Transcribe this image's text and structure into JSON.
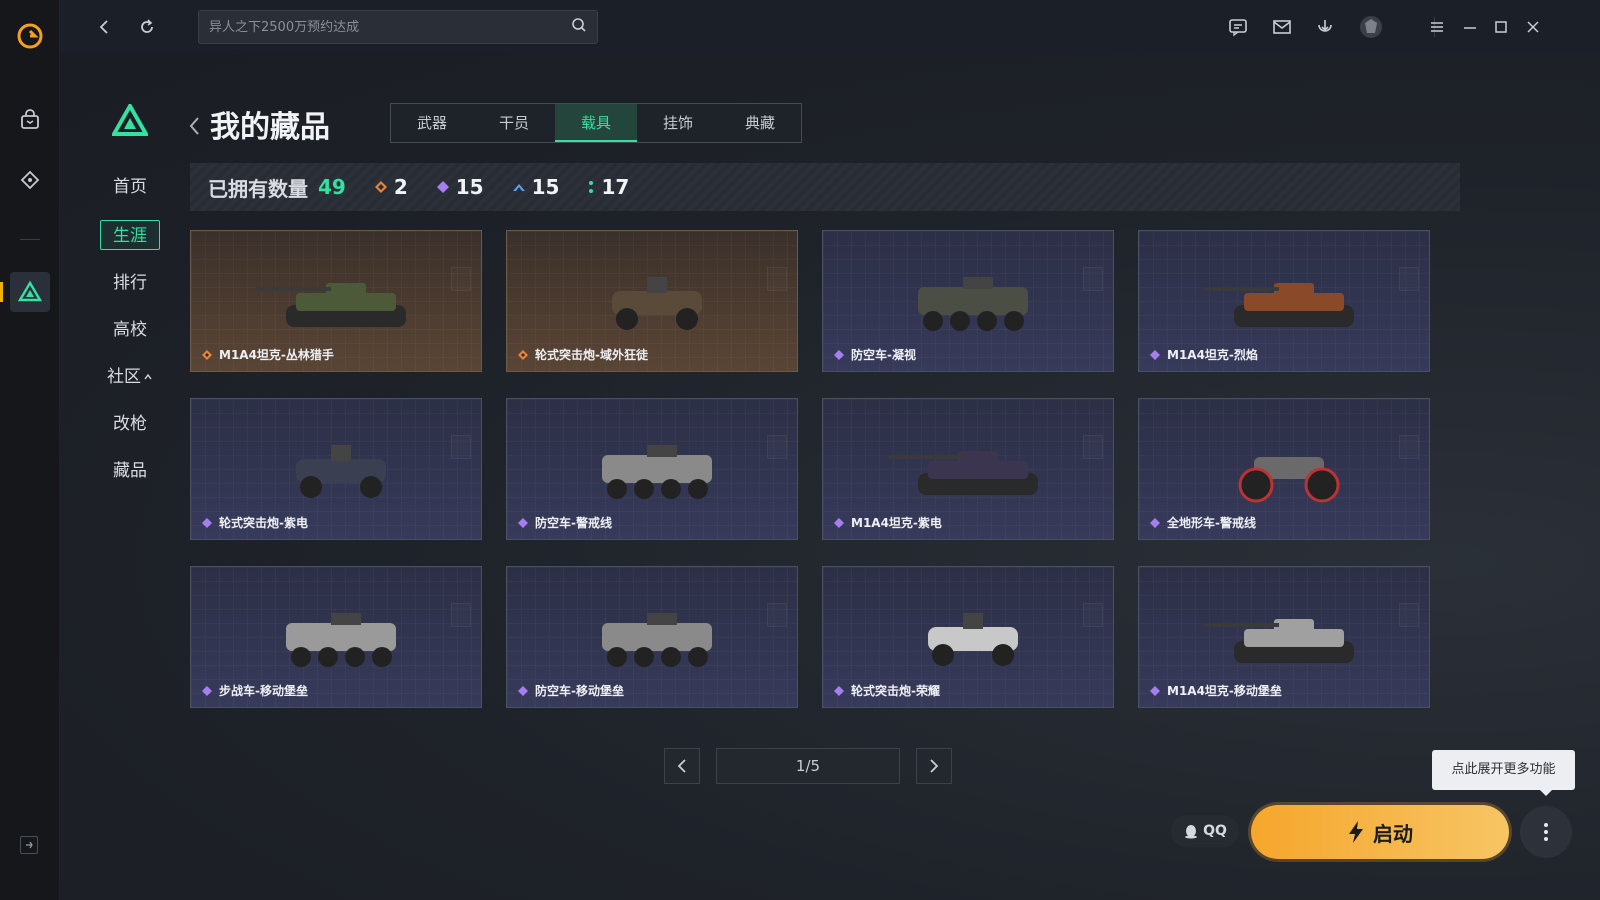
{
  "topbar": {
    "search_placeholder": "异人之下2500万预约达成"
  },
  "nav": {
    "items": [
      {
        "label": "首页",
        "active": false
      },
      {
        "label": "生涯",
        "active": true
      },
      {
        "label": "排行",
        "active": false
      },
      {
        "label": "高校",
        "active": false
      },
      {
        "label": "社区",
        "active": false,
        "expand_icon": "chevron-up-icon"
      },
      {
        "label": "改枪",
        "active": false
      },
      {
        "label": "藏品",
        "active": false
      }
    ]
  },
  "header": {
    "title": "我的藏品",
    "tabs": [
      {
        "label": "武器",
        "active": false
      },
      {
        "label": "干员",
        "active": false
      },
      {
        "label": "载具",
        "active": true
      },
      {
        "label": "挂饰",
        "active": false
      },
      {
        "label": "典藏",
        "active": false
      }
    ]
  },
  "stats": {
    "owned_label": "已拥有数量",
    "owned_count": "49",
    "rarity_counts": [
      {
        "rarity": "orange",
        "color": "#e8833a",
        "count": "2"
      },
      {
        "rarity": "purple",
        "color": "#a77ef0",
        "count": "15"
      },
      {
        "rarity": "blue",
        "color": "#5aa0f0",
        "count": "15"
      },
      {
        "rarity": "green",
        "color": "#35e0a0",
        "count": "17"
      }
    ]
  },
  "cards": [
    {
      "name": "M1A4坦克-丛林猎手",
      "rarity": "orange"
    },
    {
      "name": "轮式突击炮-域外狂徒",
      "rarity": "orange"
    },
    {
      "name": "防空车-凝视",
      "rarity": "purple"
    },
    {
      "name": "M1A4坦克-烈焰",
      "rarity": "purple"
    },
    {
      "name": "轮式突击炮-紫电",
      "rarity": "purple"
    },
    {
      "name": "防空车-警戒线",
      "rarity": "purple"
    },
    {
      "name": "M1A4坦克-紫电",
      "rarity": "purple"
    },
    {
      "name": "全地形车-警戒线",
      "rarity": "purple"
    },
    {
      "name": "步战车-移动堡垒",
      "rarity": "purple"
    },
    {
      "name": "防空车-移动堡垒",
      "rarity": "purple"
    },
    {
      "name": "轮式突击炮-荣耀",
      "rarity": "purple"
    },
    {
      "name": "M1A4坦克-移动堡垒",
      "rarity": "purple"
    }
  ],
  "pagination": {
    "label": "1/5"
  },
  "footer": {
    "tooltip": "点此展开更多功能",
    "qq_label": "QQ",
    "launch_label": "启动"
  },
  "colors": {
    "accent_green": "#35e0a0",
    "launch_orange": "#f6a62c",
    "card_purple": "#373a5a",
    "card_orange": "#5a4535"
  }
}
